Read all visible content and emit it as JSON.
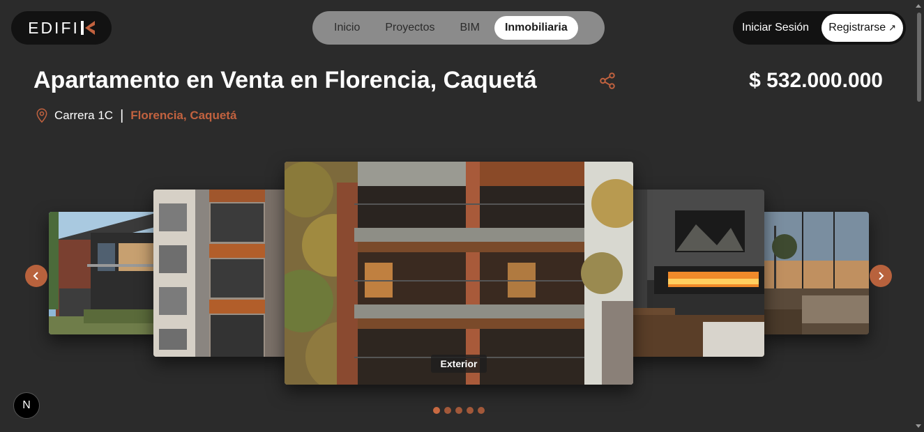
{
  "logo": {
    "text": "EDIFI",
    "mark": "K-mark"
  },
  "nav": {
    "items": [
      {
        "label": "Inicio",
        "active": false
      },
      {
        "label": "Proyectos",
        "active": false
      },
      {
        "label": "BIM",
        "active": false
      },
      {
        "label": "Inmobiliaria",
        "active": true
      }
    ]
  },
  "auth": {
    "login_label": "Iniciar Sesión",
    "register_label": "Registrarse",
    "register_icon": "↗"
  },
  "property": {
    "title": "Apartamento en Venta en Florencia, Caquetá",
    "price": "$ 532.000.000",
    "address": "Carrera 1C",
    "separator": "|",
    "city": "Florencia, Caquetá"
  },
  "carousel": {
    "active_caption": "Exterior",
    "slide_count": 5,
    "active_index": 0,
    "icons": {
      "prev": "chevron-left-icon",
      "next": "chevron-right-icon"
    }
  },
  "badge": {
    "label": "N"
  },
  "colors": {
    "accent": "#c2623f",
    "background": "#2b2b2b",
    "header_dark": "#121212",
    "nav_bg": "#8b8b8b"
  }
}
